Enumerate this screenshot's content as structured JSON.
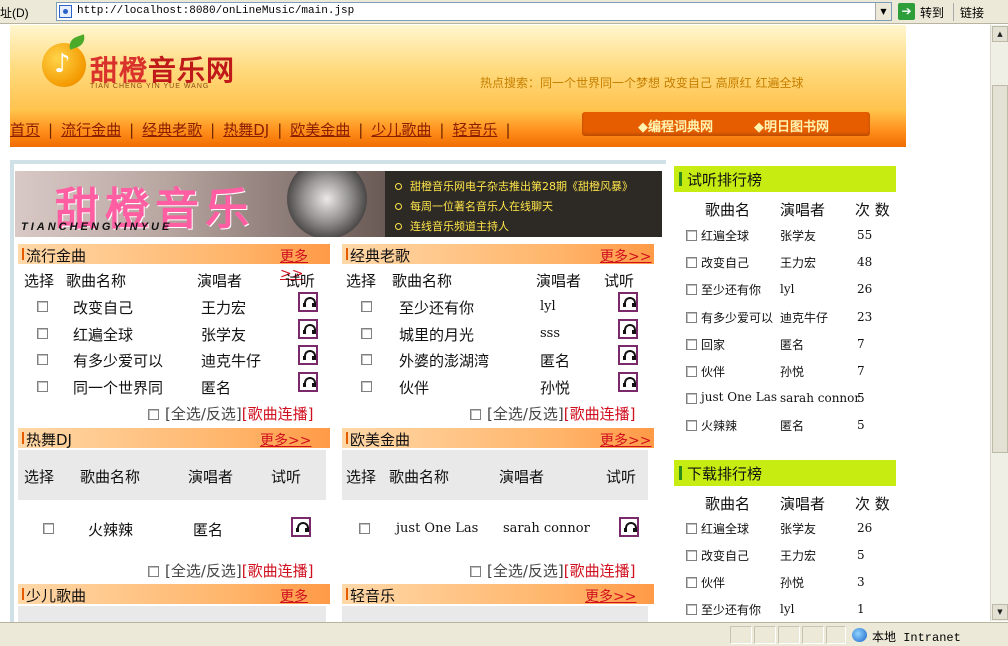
{
  "browser": {
    "address_label": "址(D)",
    "url": "http://localhost:8080/onLineMusic/main.jsp",
    "go_label": "转到",
    "links_label": "链接",
    "status_zone": "本地 Intranet"
  },
  "header": {
    "logo_title_a": "甜橙",
    "logo_title_b": "音乐网",
    "logo_sub": "TIAN CHENG YIN YUE WANG",
    "hot_search": "热点搜索：同一个世界同一个梦想 改变自己 高原红 红遍全球"
  },
  "nav": {
    "items": [
      "首页",
      "流行金曲",
      "经典老歌",
      "热舞DJ",
      "欧美金曲",
      "少儿歌曲",
      "轻音乐"
    ],
    "extra_links": [
      "◆编程词典网",
      "◆明日图书网"
    ]
  },
  "banner": {
    "title": "甜橙音乐",
    "subtitle": "TIANCHENGYINYUE",
    "news": [
      "甜橙音乐网电子杂志推出第28期《甜橙风暴》",
      "每周一位著名音乐人在线聊天",
      "连线音乐频道主持人"
    ]
  },
  "panels": {
    "more_label": "更多>>",
    "select_all": "[全选/反选]",
    "play_all": "[歌曲连播]",
    "popular": {
      "title": "流行金曲",
      "headers": [
        "选择",
        "歌曲名称",
        "演唱者",
        "试听"
      ],
      "rows": [
        {
          "song": "改变自己",
          "singer": "王力宏"
        },
        {
          "song": "红遍全球",
          "singer": "张学友"
        },
        {
          "song": "有多少爱可以",
          "singer": "迪克牛仔"
        },
        {
          "song": "同一个世界同",
          "singer": "匿名"
        }
      ]
    },
    "classic": {
      "title": "经典老歌",
      "headers": [
        "选择",
        "歌曲名称",
        "演唱者",
        "试听"
      ],
      "rows": [
        {
          "song": "至少还有你",
          "singer": "lyl"
        },
        {
          "song": "城里的月光",
          "singer": "sss"
        },
        {
          "song": "外婆的澎湖湾",
          "singer": "匿名"
        },
        {
          "song": "伙伴",
          "singer": "孙悦"
        }
      ]
    },
    "dj": {
      "title": "热舞DJ",
      "headers": [
        "选择",
        "歌曲名称",
        "演唱者",
        "试听"
      ],
      "rows": [
        {
          "song": "火辣辣",
          "singer": "匿名"
        }
      ]
    },
    "western": {
      "title": "欧美金曲",
      "headers": [
        "选择",
        "歌曲名称",
        "演唱者",
        "试听"
      ],
      "rows": [
        {
          "song": "just One Las",
          "singer": "sarah connor"
        }
      ]
    },
    "kids": {
      "title": "少儿歌曲"
    },
    "light": {
      "title": "轻音乐"
    }
  },
  "rank_listen": {
    "title": "试听排行榜",
    "headers": [
      "歌曲名",
      "演唱者",
      "次 数"
    ],
    "rows": [
      {
        "song": "红遍全球",
        "singer": "张学友",
        "count": "55"
      },
      {
        "song": "改变自己",
        "singer": "王力宏",
        "count": "48"
      },
      {
        "song": "至少还有你",
        "singer": "lyl",
        "count": "26"
      },
      {
        "song": "有多少爱可以",
        "singer": "迪克牛仔",
        "count": "23"
      },
      {
        "song": "回家",
        "singer": "匿名",
        "count": "7"
      },
      {
        "song": "伙伴",
        "singer": "孙悦",
        "count": "7"
      },
      {
        "song": "just One Las",
        "singer": "sarah connor",
        "count": "5"
      },
      {
        "song": "火辣辣",
        "singer": "匿名",
        "count": "5"
      }
    ]
  },
  "rank_download": {
    "title": "下载排行榜",
    "headers": [
      "歌曲名",
      "演唱者",
      "次 数"
    ],
    "rows": [
      {
        "song": "红遍全球",
        "singer": "张学友",
        "count": "26"
      },
      {
        "song": "改变自己",
        "singer": "王力宏",
        "count": "5"
      },
      {
        "song": "伙伴",
        "singer": "孙悦",
        "count": "3"
      },
      {
        "song": "至少还有你",
        "singer": "lyl",
        "count": "1"
      }
    ]
  },
  "colors": {
    "nav_orange": "#ff8d1a",
    "rank_green": "#c6ec12",
    "link_red": "#d0101f"
  }
}
